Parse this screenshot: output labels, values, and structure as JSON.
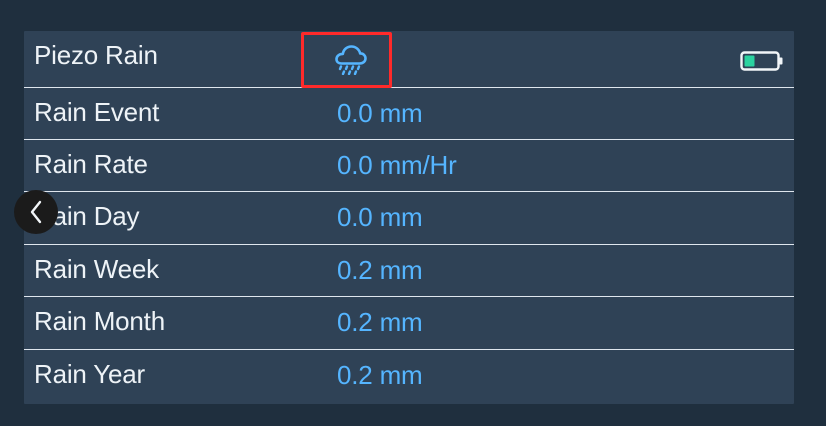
{
  "panel": {
    "title": "Piezo Rain",
    "icons": {
      "rain": "rain-cloud-icon",
      "battery": "battery-icon",
      "back": "chevron-left-icon"
    },
    "rows": [
      {
        "label": "Rain Event",
        "value": "0.0 mm"
      },
      {
        "label": "Rain Rate",
        "value": "0.0 mm/Hr"
      },
      {
        "label": "Rain Day",
        "value": "0.0 mm"
      },
      {
        "label": "Rain Week",
        "value": "0.2 mm"
      },
      {
        "label": "Rain Month",
        "value": "0.2 mm"
      },
      {
        "label": "Rain Year",
        "value": "0.2 mm"
      }
    ]
  },
  "colors": {
    "background": "#1f2f3e",
    "panel": "#2f4256",
    "label": "#eef3f7",
    "value": "#55b5ff",
    "highlight": "#ff2a2a",
    "battery": "#2bd3a0"
  }
}
